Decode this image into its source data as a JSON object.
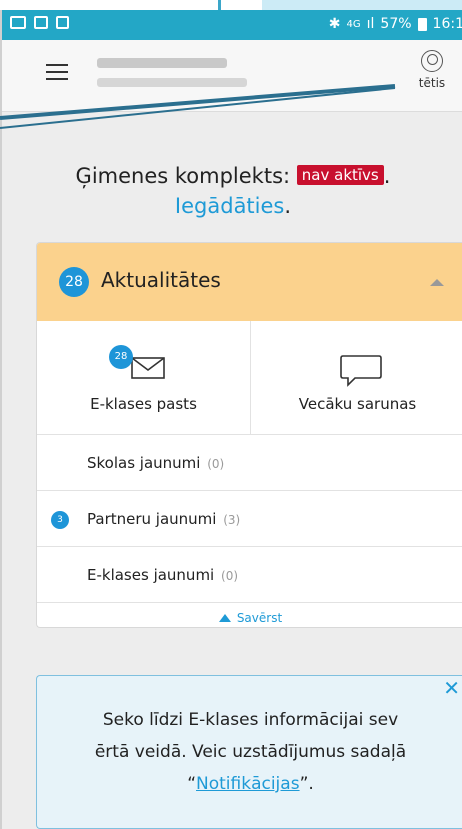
{
  "statusbar": {
    "bluetooth": "✱",
    "network": "4G",
    "signal": "ıl",
    "battery_percent": "57%",
    "time": "16:1"
  },
  "header": {
    "menu_icon": "hamburger-icon",
    "profile_name": "tētis",
    "profile_icon": "user-avatar-icon"
  },
  "family_package": {
    "label": "Ģimenes komplekts:",
    "status_badge": "nav aktīvs",
    "period": ".",
    "action_link": "Iegādāties",
    "action_suffix": "."
  },
  "news_panel": {
    "count": "28",
    "title": "Aktualitātes",
    "tiles": [
      {
        "label": "E-klases pasts",
        "badge": "28",
        "icon": "envelope-icon"
      },
      {
        "label": "Vecāku sarunas",
        "icon": "chat-bubble-icon"
      }
    ],
    "rows": [
      {
        "label": "Skolas jaunumi",
        "count": "(0)",
        "badge": ""
      },
      {
        "label": "Partneru jaunumi",
        "count": "(3)",
        "badge": "3"
      },
      {
        "label": "E-klases jaunumi",
        "count": "(0)",
        "badge": ""
      }
    ],
    "collapse_label": "Savērst"
  },
  "notice": {
    "line1": "Seko līdzi E-klases informācijai sev",
    "line2": "ērtā veidā. Veic uzstādījumus sadaļā",
    "quote_open": "“",
    "link": "Notifikācijas",
    "quote_close": "”.",
    "close": "✕"
  },
  "colors": {
    "statusbar": "#23a7c6",
    "panel_header": "#fbd28d",
    "badge_blue": "#1e95d8",
    "badge_red": "#c8102e",
    "link": "#1e9ad6",
    "notice_bg": "#e7f3f9"
  }
}
